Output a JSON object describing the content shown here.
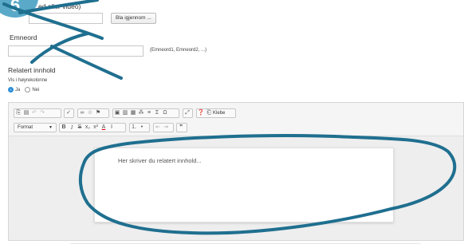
{
  "step_badge": "6",
  "media": {
    "label_partial": "ed eller video)",
    "browse_label": "Bla igjennom ..."
  },
  "keywords": {
    "label": "Emneord",
    "hint": "(Emneord1, Emneord2, ...)"
  },
  "related": {
    "heading": "Relatert innhold",
    "right_column_label": "Vis i høyrekolonne",
    "options": [
      {
        "label": "Ja",
        "selected": true
      },
      {
        "label": "Nei",
        "selected": false
      }
    ]
  },
  "editor": {
    "paste_label": "Klebe",
    "format_label": "Format",
    "placeholder": "Her skriver du relatert innhold...",
    "toolbar_row1": [
      "copy-icon",
      "paste-text-icon",
      "undo-icon",
      "redo-icon",
      "spellcheck-icon",
      "link-icon",
      "unlink-icon",
      "anchor-icon",
      "image-icon",
      "media-icon",
      "table-icon",
      "horizontal-rule-icon",
      "special-char-icon",
      "sigma-icon",
      "omega-icon",
      "maximize-icon",
      "help-icon",
      "paste-icon"
    ],
    "toolbar_row2": [
      "bold-icon",
      "italic-icon",
      "strike-icon",
      "subscript-icon",
      "superscript-icon",
      "text-color-icon",
      "remove-format-icon",
      "ordered-list-icon",
      "bullet-list-icon",
      "outdent-icon",
      "indent-icon",
      "blockquote-icon"
    ]
  },
  "annotation_color": "#1f6f8f"
}
